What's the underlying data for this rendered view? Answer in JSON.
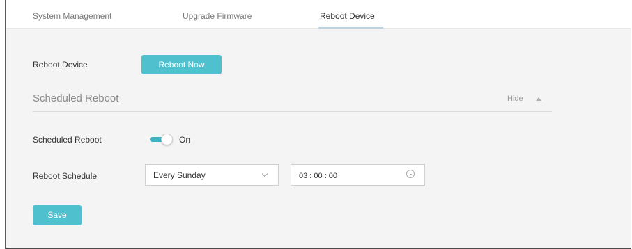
{
  "tabs": [
    {
      "label": "System Management",
      "active": false
    },
    {
      "label": "Upgrade Firmware",
      "active": false
    },
    {
      "label": "Reboot Device",
      "active": true
    }
  ],
  "reboot": {
    "label": "Reboot Device",
    "button": "Reboot Now"
  },
  "scheduled": {
    "section_title": "Scheduled Reboot",
    "hide_label": "Hide",
    "toggle_label": "Scheduled Reboot",
    "toggle_state": "On",
    "toggle_on": true,
    "schedule_label": "Reboot Schedule",
    "schedule_value": "Every Sunday",
    "time_value": "03 : 00 : 00",
    "save_button": "Save"
  },
  "colors": {
    "accent": "#4fc1ce",
    "toggle_track": "#3bb4c1",
    "background": "#f4f4f4"
  },
  "icons": {
    "dropdown": "chevron-down-icon",
    "collapse": "caret-up-icon",
    "time": "clock-icon"
  }
}
